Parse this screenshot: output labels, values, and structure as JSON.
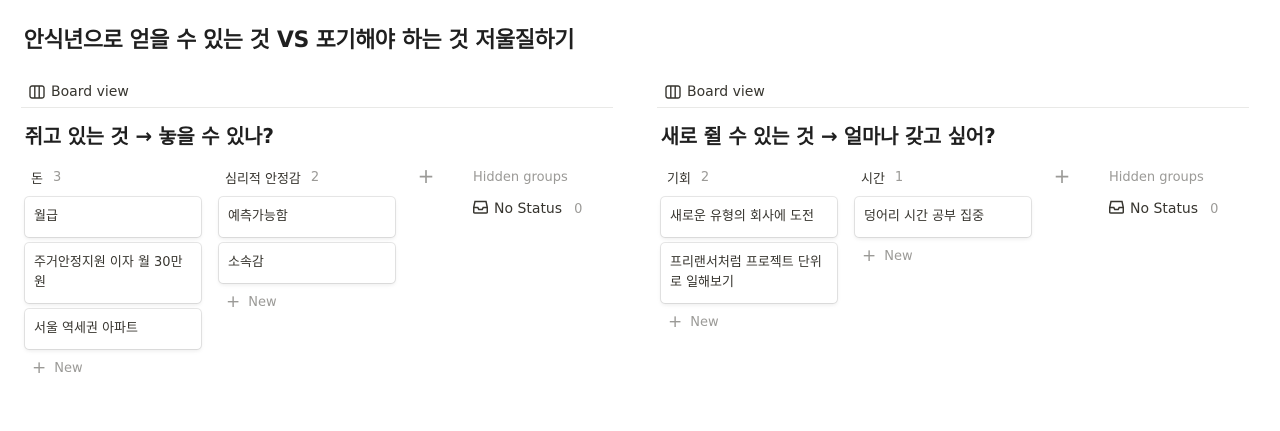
{
  "page": {
    "title": "안식년으로 얻을 수 있는 것 VS 포기해야 하는 것 저울질하기"
  },
  "boards": [
    {
      "view_tab": {
        "label": "Board view",
        "icon": "board-icon"
      },
      "title": "쥐고 있는 것 → 놓을 수 있나?",
      "columns": [
        {
          "name": "돈",
          "count": "3",
          "cards": [
            "월급",
            "주거안정지원 이자 월 30만 원",
            "서울 역세권 아파트"
          ],
          "new_label": "New"
        },
        {
          "name": "심리적 안정감",
          "count": "2",
          "cards": [
            "예측가능함",
            "소속감"
          ],
          "new_label": "New"
        }
      ],
      "add_group_icon": "plus-icon",
      "hidden_groups": {
        "label": "Hidden groups",
        "item": {
          "icon": "inbox-icon",
          "label": "No Status",
          "count": "0"
        }
      }
    },
    {
      "view_tab": {
        "label": "Board view",
        "icon": "board-icon"
      },
      "title": "새로 쥘 수 있는 것 → 얼마나 갖고 싶어?",
      "columns": [
        {
          "name": "기회",
          "count": "2",
          "cards": [
            "새로운 유형의 회사에 도전",
            "프리랜서처럼 프로젝트 단위로 일해보기"
          ],
          "new_label": "New"
        },
        {
          "name": "시간",
          "count": "1",
          "cards": [
            "덩어리 시간 공부 집중"
          ],
          "new_label": "New"
        }
      ],
      "add_group_icon": "plus-icon",
      "hidden_groups": {
        "label": "Hidden groups",
        "item": {
          "icon": "inbox-icon",
          "label": "No Status",
          "count": "0"
        }
      }
    }
  ]
}
